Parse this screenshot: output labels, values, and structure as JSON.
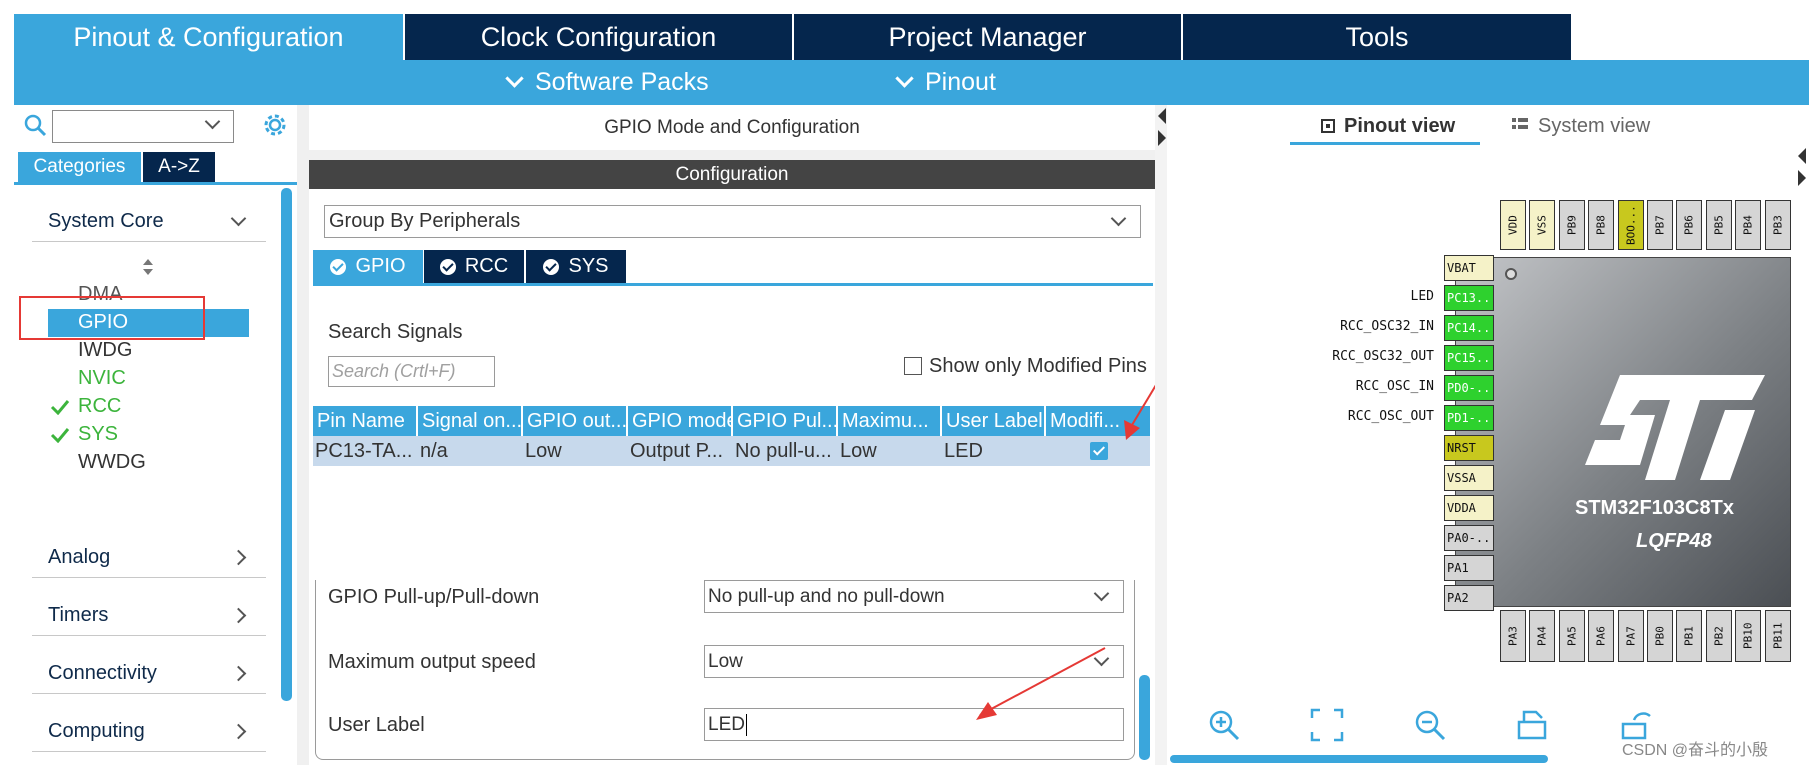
{
  "top_tabs": [
    {
      "label": "Pinout & Configuration",
      "active": true
    },
    {
      "label": "Clock Configuration",
      "active": false
    },
    {
      "label": "Project Manager",
      "active": false
    },
    {
      "label": "Tools",
      "active": false
    }
  ],
  "sub_menu": [
    {
      "label": "Software Packs"
    },
    {
      "label": "Pinout"
    }
  ],
  "left_panel": {
    "search_value": "",
    "category_tabs": [
      "Categories",
      "A->Z"
    ],
    "system_core": {
      "label": "System Core",
      "items": [
        {
          "label": "DMA",
          "status": "none"
        },
        {
          "label": "GPIO",
          "status": "selected"
        },
        {
          "label": "IWDG",
          "status": "none"
        },
        {
          "label": "NVIC",
          "status": "green"
        },
        {
          "label": "RCC",
          "status": "checked"
        },
        {
          "label": "SYS",
          "status": "checked"
        },
        {
          "label": "WWDG",
          "status": "none"
        }
      ]
    },
    "sections": [
      "Analog",
      "Timers",
      "Connectivity",
      "Computing"
    ]
  },
  "middle_panel": {
    "title": "GPIO Mode and Configuration",
    "config_header": "Configuration",
    "group_by": "Group By Peripherals",
    "peripheral_tabs": [
      "GPIO",
      "RCC",
      "SYS"
    ],
    "search_label": "Search Signals",
    "search_placeholder": "Search (Crtl+F)",
    "show_modified_label": "Show only Modified Pins",
    "table": {
      "headers": [
        "Pin Name",
        "Signal on...",
        "GPIO out...",
        "GPIO mode",
        "GPIO Pul...",
        "Maximu...",
        "User Label",
        "Modifi..."
      ],
      "rows": [
        {
          "pin": "PC13-TA...",
          "signal": "n/a",
          "gpio_out": "Low",
          "gpio_mode": "Output P...",
          "pull": "No pull-u...",
          "max": "Low",
          "user_label": "LED",
          "modified": true
        }
      ]
    },
    "properties": [
      {
        "label": "GPIO Pull-up/Pull-down",
        "value": "No pull-up and no pull-down",
        "type": "select"
      },
      {
        "label": "Maximum output speed",
        "value": "Low",
        "type": "select"
      },
      {
        "label": "User Label",
        "value": "LED",
        "type": "text"
      }
    ]
  },
  "right_panel": {
    "view_tabs": [
      "Pinout view",
      "System view"
    ],
    "chip_name": "STM32F103C8Tx",
    "chip_package": "LQFP48",
    "top_pins": [
      "VDD",
      "VSS",
      "PB9",
      "PB8",
      "BOO...",
      "PB7",
      "PB6",
      "PB5",
      "PB4",
      "PB3"
    ],
    "left_pins": [
      {
        "name": "VBAT",
        "label": "",
        "color": "#f5f2c8"
      },
      {
        "name": "PC13..",
        "label": "LED",
        "color": "#2ed12e"
      },
      {
        "name": "PC14..",
        "label": "RCC_OSC32_IN",
        "color": "#2ed12e"
      },
      {
        "name": "PC15..",
        "label": "RCC_OSC32_OUT",
        "color": "#2ed12e"
      },
      {
        "name": "PD0-..",
        "label": "RCC_OSC_IN",
        "color": "#2ed12e"
      },
      {
        "name": "PD1-..",
        "label": "RCC_OSC_OUT",
        "color": "#2ed12e"
      },
      {
        "name": "NRST",
        "label": "",
        "color": "#c8c81e"
      },
      {
        "name": "VSSA",
        "label": "",
        "color": "#f5f2c8"
      },
      {
        "name": "VDDA",
        "label": "",
        "color": "#f5f2c8"
      },
      {
        "name": "PA0-..",
        "label": "",
        "color": "#d5d5d5"
      },
      {
        "name": "PA1",
        "label": "",
        "color": "#d5d5d5"
      },
      {
        "name": "PA2",
        "label": "",
        "color": "#d5d5d5"
      }
    ],
    "bottom_pins": [
      "PA3",
      "PA4",
      "PA5",
      "PA6",
      "PA7",
      "PB0",
      "PB1",
      "PB2",
      "PB10",
      "PB11"
    ],
    "watermark": "CSDN @奋斗的小殷"
  },
  "colors": {
    "accent": "#3aa6dc",
    "navy": "#05264d",
    "pin_green": "#2ed12e",
    "pin_yellow": "#c8c81e",
    "annotation_red": "#e53935"
  }
}
